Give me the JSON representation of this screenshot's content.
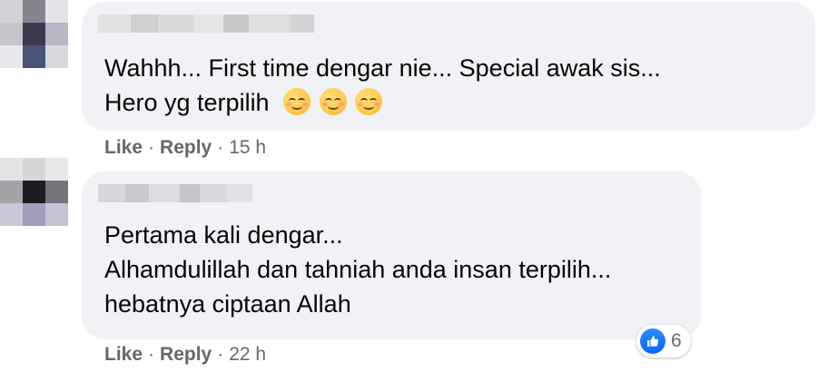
{
  "comments": [
    {
      "text_lines": [
        "Wahhh... First time dengar nie... Special awak sis...",
        "Hero yg terpilih"
      ],
      "emojis": [
        "smiling-face-with-smiling-eyes-icon",
        "smiling-face-with-smiling-eyes-icon",
        "smiling-face-with-smiling-eyes-icon"
      ],
      "actions": {
        "like": "Like",
        "reply": "Reply",
        "time": "15 h"
      }
    },
    {
      "text_lines": [
        "Pertama kali dengar...",
        "Alhamdulillah dan tahniah anda insan terpilih...",
        "hebatnya ciptaan Allah"
      ],
      "actions": {
        "like": "Like",
        "reply": "Reply",
        "time": "22 h"
      },
      "reaction": {
        "icon": "like-thumb-icon",
        "count": "6"
      }
    }
  ],
  "separator": "·",
  "colors": {
    "bubble": "#f0f2f5",
    "action_text": "#65676b",
    "like_blue": "#0866ff"
  }
}
